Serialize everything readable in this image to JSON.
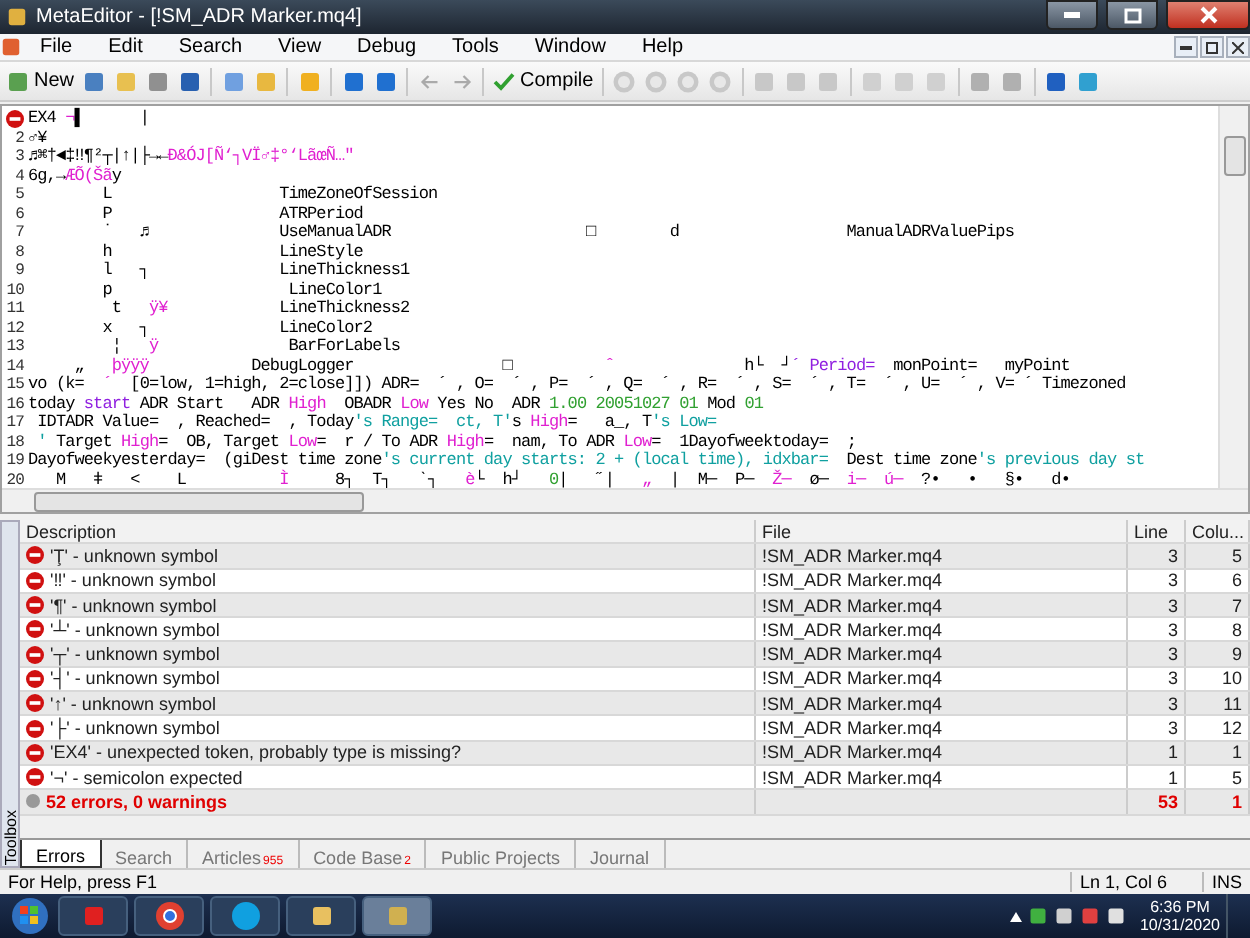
{
  "window": {
    "title": "MetaEditor - [!SM_ADR Marker.mq4]"
  },
  "menu": [
    "File",
    "Edit",
    "Search",
    "View",
    "Debug",
    "Tools",
    "Window",
    "Help"
  ],
  "toolbar": {
    "new_label": "New",
    "compile_label": "Compile"
  },
  "editor": {
    "lines": [
      {
        "error": true,
        "segments": [
          {
            "text": "EX4 ",
            "kind": "plain"
          },
          {
            "text": "¬",
            "kind": "pink"
          },
          {
            "text": "▌      |",
            "kind": "plain"
          }
        ]
      },
      {
        "number": "2",
        "segments": [
          {
            "text": "♂¥",
            "kind": "plain"
          }
        ]
      },
      {
        "number": "3",
        "segments": [
          {
            "text": "♬⌘†◄‡‼¶²┬|↑|├→←",
            "kind": "plain"
          },
          {
            "text": "Ð&ÓJ[Ñ‘┐VÏ♂‡°‘LãœÑ…\"",
            "kind": "pink"
          }
        ]
      },
      {
        "number": "4",
        "segments": [
          {
            "text": "6g,→",
            "kind": "plain"
          },
          {
            "text": "ÆÕ(Šã",
            "kind": "pink"
          },
          {
            "text": "y",
            "kind": "plain"
          }
        ]
      },
      {
        "number": "5",
        "segments": [
          {
            "text": "        L                  TimeZoneOfSession",
            "kind": "plain"
          }
        ]
      },
      {
        "number": "6",
        "segments": [
          {
            "text": "        P                  ATRPeriod",
            "kind": "plain"
          }
        ]
      },
      {
        "number": "7",
        "segments": [
          {
            "text": "        ˙   ♬              UseManualADR                     □        d                  ManualADRValuePips",
            "kind": "plain"
          }
        ]
      },
      {
        "number": "8",
        "segments": [
          {
            "text": "        h                  LineStyle",
            "kind": "plain"
          }
        ]
      },
      {
        "number": "9",
        "segments": [
          {
            "text": "        l   ┐              LineThickness1",
            "kind": "plain"
          }
        ]
      },
      {
        "number": "10",
        "segments": [
          {
            "text": "        p                   LineColor1",
            "kind": "plain"
          }
        ]
      },
      {
        "number": "11",
        "segments": [
          {
            "text": "         t   ",
            "kind": "plain"
          },
          {
            "text": "ÿ¥",
            "kind": "pink"
          },
          {
            "text": "            LineThickness2",
            "kind": "plain"
          }
        ]
      },
      {
        "number": "12",
        "segments": [
          {
            "text": "        x   ┐              LineColor2",
            "kind": "plain"
          }
        ]
      },
      {
        "number": "13",
        "segments": [
          {
            "text": "         ¦   ",
            "kind": "plain"
          },
          {
            "text": "ÿ",
            "kind": "pink"
          },
          {
            "text": "              BarForLabels",
            "kind": "plain"
          }
        ]
      },
      {
        "number": "14",
        "segments": [
          {
            "text": "     „   ",
            "kind": "plain"
          },
          {
            "text": "þÿÿÿ",
            "kind": "pink"
          },
          {
            "text": "           DebugLogger                □          ",
            "kind": "plain"
          },
          {
            "text": "ˆ",
            "kind": "pink"
          },
          {
            "text": "              h└  ┘",
            "kind": "plain"
          },
          {
            "text": "´ Period=",
            "kind": "purple"
          },
          {
            "text": "  monPoint=   myPoint",
            "kind": "plain"
          }
        ]
      },
      {
        "number": "15",
        "segments": [
          {
            "text": "vo (k=  ",
            "kind": "plain"
          },
          {
            "text": "´",
            "kind": "pink"
          },
          {
            "text": "  [0=low, 1=high, 2=close]]) ADR=  ´ , O=  ´ , P=  ´ , Q=  ´ , R=  ´ , S=  ´ , T=  ´ , U=  ´ , V= ´ Timezoned",
            "kind": "plain"
          }
        ]
      },
      {
        "number": "16",
        "segments": [
          {
            "text": "today ",
            "kind": "plain"
          },
          {
            "text": "start",
            "kind": "purple"
          },
          {
            "text": " ADR Start   ADR ",
            "kind": "plain"
          },
          {
            "text": "High",
            "kind": "pink"
          },
          {
            "text": "  OBADR ",
            "kind": "plain"
          },
          {
            "text": "Low",
            "kind": "pink"
          },
          {
            "text": " Yes No  ADR ",
            "kind": "plain"
          },
          {
            "text": "1.00 20051027 01",
            "kind": "green"
          },
          {
            "text": " Mod ",
            "kind": "plain"
          },
          {
            "text": "01",
            "kind": "green"
          }
        ]
      },
      {
        "number": "17",
        "segments": [
          {
            "text": " IDTADR Value=  , Reached=  , Today",
            "kind": "plain"
          },
          {
            "text": "'s Range=  ct, T'",
            "kind": "teal"
          },
          {
            "text": "s ",
            "kind": "plain"
          },
          {
            "text": "High",
            "kind": "pink"
          },
          {
            "text": "=   a_, T",
            "kind": "plain"
          },
          {
            "text": "'s Low=",
            "kind": "teal"
          }
        ]
      },
      {
        "number": "18",
        "segments": [
          {
            "text": " ' ",
            "kind": "teal"
          },
          {
            "text": "Target ",
            "kind": "plain"
          },
          {
            "text": "High",
            "kind": "pink"
          },
          {
            "text": "=  OB, Target ",
            "kind": "plain"
          },
          {
            "text": "Low",
            "kind": "pink"
          },
          {
            "text": "=  r / To ADR ",
            "kind": "plain"
          },
          {
            "text": "High",
            "kind": "pink"
          },
          {
            "text": "=  nam, To ADR ",
            "kind": "plain"
          },
          {
            "text": "Low",
            "kind": "pink"
          },
          {
            "text": "=  1Dayofweektoday=  ;",
            "kind": "plain"
          }
        ]
      },
      {
        "number": "19",
        "segments": [
          {
            "text": "Dayofweekyesterday=  (giDest time zone",
            "kind": "plain"
          },
          {
            "text": "'s current day starts: 2 + (local time), idxbar=  ",
            "kind": "teal"
          },
          {
            "text": "Dest time zone",
            "kind": "plain"
          },
          {
            "text": "'s previous day st",
            "kind": "teal"
          }
        ]
      },
      {
        "number": "20",
        "segments": [
          {
            "text": "   M   ǂ   <    L          ",
            "kind": "plain"
          },
          {
            "text": "Ì",
            "kind": "pink"
          },
          {
            "text": "     8┐  T┐   ˋ┐   ",
            "kind": "plain"
          },
          {
            "text": "è",
            "kind": "pink"
          },
          {
            "text": "└  h┘   ",
            "kind": "plain"
          },
          {
            "text": "0",
            "kind": "green"
          },
          {
            "text": "|   ˝|   ",
            "kind": "plain"
          },
          {
            "text": "„",
            "kind": "pink"
          },
          {
            "text": "  |  M─  P─  ",
            "kind": "plain"
          },
          {
            "text": "Ž─",
            "kind": "pink"
          },
          {
            "text": "  ø─  ",
            "kind": "plain"
          },
          {
            "text": "i─  ú─",
            "kind": "pink"
          },
          {
            "text": "  ?•   •   §•   d•",
            "kind": "plain"
          }
        ]
      }
    ]
  },
  "toolbox": {
    "label": "Toolbox",
    "columns": [
      "Description",
      "File",
      "Line",
      "Colu..."
    ],
    "rows": [
      {
        "kind": "error",
        "description": "'Ţ' - unknown symbol",
        "file": "!SM_ADR Marker.mq4",
        "line": "3",
        "column": "5"
      },
      {
        "kind": "error",
        "description": "'‼' - unknown symbol",
        "file": "!SM_ADR Marker.mq4",
        "line": "3",
        "column": "6"
      },
      {
        "kind": "error",
        "description": "'¶' - unknown symbol",
        "file": "!SM_ADR Marker.mq4",
        "line": "3",
        "column": "7"
      },
      {
        "kind": "error",
        "description": "'┴' - unknown symbol",
        "file": "!SM_ADR Marker.mq4",
        "line": "3",
        "column": "8"
      },
      {
        "kind": "error",
        "description": "'┬' - unknown symbol",
        "file": "!SM_ADR Marker.mq4",
        "line": "3",
        "column": "9"
      },
      {
        "kind": "error",
        "description": "'┤' - unknown symbol",
        "file": "!SM_ADR Marker.mq4",
        "line": "3",
        "column": "10"
      },
      {
        "kind": "error",
        "description": "'↑' - unknown symbol",
        "file": "!SM_ADR Marker.mq4",
        "line": "3",
        "column": "11"
      },
      {
        "kind": "error",
        "description": "'├' - unknown symbol",
        "file": "!SM_ADR Marker.mq4",
        "line": "3",
        "column": "12"
      },
      {
        "kind": "error",
        "description": "'EX4' - unexpected token, probably type is missing?",
        "file": "!SM_ADR Marker.mq4",
        "line": "1",
        "column": "1"
      },
      {
        "kind": "error",
        "description": "'¬' - semicolon expected",
        "file": "!SM_ADR Marker.mq4",
        "line": "1",
        "column": "5"
      },
      {
        "kind": "summary",
        "description": "52 errors, 0 warnings",
        "file": "",
        "line": "53",
        "column": "1"
      }
    ],
    "tabs": [
      {
        "label": "Errors",
        "selected": true
      },
      {
        "label": "Search",
        "selected": false
      },
      {
        "label": "Articles",
        "badge": "955",
        "selected": false
      },
      {
        "label": "Code Base",
        "badge": "2",
        "selected": false
      },
      {
        "label": "Public Projects",
        "selected": false
      },
      {
        "label": "Journal",
        "selected": false
      }
    ]
  },
  "status_bar": {
    "help": "For Help, press F1",
    "position": "Ln 1, Col 6",
    "mode": "INS"
  },
  "taskbar": {
    "time": "6:36 PM",
    "date": "10/31/2020"
  }
}
